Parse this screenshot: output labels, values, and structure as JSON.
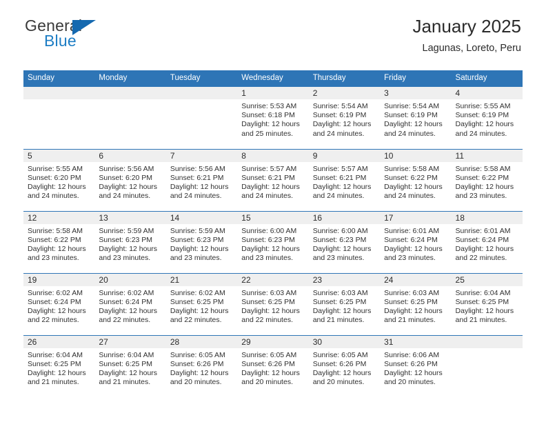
{
  "logo": {
    "word_one": "General",
    "word_two": "Blue",
    "triangle_icon": "triangle-icon"
  },
  "header": {
    "title": "January 2025",
    "subtitle": "Lagunas, Loreto, Peru"
  },
  "colors": {
    "header_blue": "#2E75B6",
    "logo_blue": "#1D7DC4",
    "daynum_band": "#EFEFEF",
    "text": "#2B2B2B"
  },
  "weekday_headers": [
    "Sunday",
    "Monday",
    "Tuesday",
    "Wednesday",
    "Thursday",
    "Friday",
    "Saturday"
  ],
  "weeks": [
    [
      {
        "day": "",
        "empty": true,
        "sunrise": "",
        "sunset": "",
        "daylight_line1": "",
        "daylight_line2": ""
      },
      {
        "day": "",
        "empty": true,
        "sunrise": "",
        "sunset": "",
        "daylight_line1": "",
        "daylight_line2": ""
      },
      {
        "day": "",
        "empty": true,
        "sunrise": "",
        "sunset": "",
        "daylight_line1": "",
        "daylight_line2": ""
      },
      {
        "day": "1",
        "empty": false,
        "sunrise": "Sunrise: 5:53 AM",
        "sunset": "Sunset: 6:18 PM",
        "daylight_line1": "Daylight: 12 hours",
        "daylight_line2": "and 25 minutes."
      },
      {
        "day": "2",
        "empty": false,
        "sunrise": "Sunrise: 5:54 AM",
        "sunset": "Sunset: 6:19 PM",
        "daylight_line1": "Daylight: 12 hours",
        "daylight_line2": "and 24 minutes."
      },
      {
        "day": "3",
        "empty": false,
        "sunrise": "Sunrise: 5:54 AM",
        "sunset": "Sunset: 6:19 PM",
        "daylight_line1": "Daylight: 12 hours",
        "daylight_line2": "and 24 minutes."
      },
      {
        "day": "4",
        "empty": false,
        "sunrise": "Sunrise: 5:55 AM",
        "sunset": "Sunset: 6:19 PM",
        "daylight_line1": "Daylight: 12 hours",
        "daylight_line2": "and 24 minutes."
      }
    ],
    [
      {
        "day": "5",
        "empty": false,
        "sunrise": "Sunrise: 5:55 AM",
        "sunset": "Sunset: 6:20 PM",
        "daylight_line1": "Daylight: 12 hours",
        "daylight_line2": "and 24 minutes."
      },
      {
        "day": "6",
        "empty": false,
        "sunrise": "Sunrise: 5:56 AM",
        "sunset": "Sunset: 6:20 PM",
        "daylight_line1": "Daylight: 12 hours",
        "daylight_line2": "and 24 minutes."
      },
      {
        "day": "7",
        "empty": false,
        "sunrise": "Sunrise: 5:56 AM",
        "sunset": "Sunset: 6:21 PM",
        "daylight_line1": "Daylight: 12 hours",
        "daylight_line2": "and 24 minutes."
      },
      {
        "day": "8",
        "empty": false,
        "sunrise": "Sunrise: 5:57 AM",
        "sunset": "Sunset: 6:21 PM",
        "daylight_line1": "Daylight: 12 hours",
        "daylight_line2": "and 24 minutes."
      },
      {
        "day": "9",
        "empty": false,
        "sunrise": "Sunrise: 5:57 AM",
        "sunset": "Sunset: 6:21 PM",
        "daylight_line1": "Daylight: 12 hours",
        "daylight_line2": "and 24 minutes."
      },
      {
        "day": "10",
        "empty": false,
        "sunrise": "Sunrise: 5:58 AM",
        "sunset": "Sunset: 6:22 PM",
        "daylight_line1": "Daylight: 12 hours",
        "daylight_line2": "and 24 minutes."
      },
      {
        "day": "11",
        "empty": false,
        "sunrise": "Sunrise: 5:58 AM",
        "sunset": "Sunset: 6:22 PM",
        "daylight_line1": "Daylight: 12 hours",
        "daylight_line2": "and 23 minutes."
      }
    ],
    [
      {
        "day": "12",
        "empty": false,
        "sunrise": "Sunrise: 5:58 AM",
        "sunset": "Sunset: 6:22 PM",
        "daylight_line1": "Daylight: 12 hours",
        "daylight_line2": "and 23 minutes."
      },
      {
        "day": "13",
        "empty": false,
        "sunrise": "Sunrise: 5:59 AM",
        "sunset": "Sunset: 6:23 PM",
        "daylight_line1": "Daylight: 12 hours",
        "daylight_line2": "and 23 minutes."
      },
      {
        "day": "14",
        "empty": false,
        "sunrise": "Sunrise: 5:59 AM",
        "sunset": "Sunset: 6:23 PM",
        "daylight_line1": "Daylight: 12 hours",
        "daylight_line2": "and 23 minutes."
      },
      {
        "day": "15",
        "empty": false,
        "sunrise": "Sunrise: 6:00 AM",
        "sunset": "Sunset: 6:23 PM",
        "daylight_line1": "Daylight: 12 hours",
        "daylight_line2": "and 23 minutes."
      },
      {
        "day": "16",
        "empty": false,
        "sunrise": "Sunrise: 6:00 AM",
        "sunset": "Sunset: 6:23 PM",
        "daylight_line1": "Daylight: 12 hours",
        "daylight_line2": "and 23 minutes."
      },
      {
        "day": "17",
        "empty": false,
        "sunrise": "Sunrise: 6:01 AM",
        "sunset": "Sunset: 6:24 PM",
        "daylight_line1": "Daylight: 12 hours",
        "daylight_line2": "and 23 minutes."
      },
      {
        "day": "18",
        "empty": false,
        "sunrise": "Sunrise: 6:01 AM",
        "sunset": "Sunset: 6:24 PM",
        "daylight_line1": "Daylight: 12 hours",
        "daylight_line2": "and 22 minutes."
      }
    ],
    [
      {
        "day": "19",
        "empty": false,
        "sunrise": "Sunrise: 6:02 AM",
        "sunset": "Sunset: 6:24 PM",
        "daylight_line1": "Daylight: 12 hours",
        "daylight_line2": "and 22 minutes."
      },
      {
        "day": "20",
        "empty": false,
        "sunrise": "Sunrise: 6:02 AM",
        "sunset": "Sunset: 6:24 PM",
        "daylight_line1": "Daylight: 12 hours",
        "daylight_line2": "and 22 minutes."
      },
      {
        "day": "21",
        "empty": false,
        "sunrise": "Sunrise: 6:02 AM",
        "sunset": "Sunset: 6:25 PM",
        "daylight_line1": "Daylight: 12 hours",
        "daylight_line2": "and 22 minutes."
      },
      {
        "day": "22",
        "empty": false,
        "sunrise": "Sunrise: 6:03 AM",
        "sunset": "Sunset: 6:25 PM",
        "daylight_line1": "Daylight: 12 hours",
        "daylight_line2": "and 22 minutes."
      },
      {
        "day": "23",
        "empty": false,
        "sunrise": "Sunrise: 6:03 AM",
        "sunset": "Sunset: 6:25 PM",
        "daylight_line1": "Daylight: 12 hours",
        "daylight_line2": "and 21 minutes."
      },
      {
        "day": "24",
        "empty": false,
        "sunrise": "Sunrise: 6:03 AM",
        "sunset": "Sunset: 6:25 PM",
        "daylight_line1": "Daylight: 12 hours",
        "daylight_line2": "and 21 minutes."
      },
      {
        "day": "25",
        "empty": false,
        "sunrise": "Sunrise: 6:04 AM",
        "sunset": "Sunset: 6:25 PM",
        "daylight_line1": "Daylight: 12 hours",
        "daylight_line2": "and 21 minutes."
      }
    ],
    [
      {
        "day": "26",
        "empty": false,
        "sunrise": "Sunrise: 6:04 AM",
        "sunset": "Sunset: 6:25 PM",
        "daylight_line1": "Daylight: 12 hours",
        "daylight_line2": "and 21 minutes."
      },
      {
        "day": "27",
        "empty": false,
        "sunrise": "Sunrise: 6:04 AM",
        "sunset": "Sunset: 6:25 PM",
        "daylight_line1": "Daylight: 12 hours",
        "daylight_line2": "and 21 minutes."
      },
      {
        "day": "28",
        "empty": false,
        "sunrise": "Sunrise: 6:05 AM",
        "sunset": "Sunset: 6:26 PM",
        "daylight_line1": "Daylight: 12 hours",
        "daylight_line2": "and 20 minutes."
      },
      {
        "day": "29",
        "empty": false,
        "sunrise": "Sunrise: 6:05 AM",
        "sunset": "Sunset: 6:26 PM",
        "daylight_line1": "Daylight: 12 hours",
        "daylight_line2": "and 20 minutes."
      },
      {
        "day": "30",
        "empty": false,
        "sunrise": "Sunrise: 6:05 AM",
        "sunset": "Sunset: 6:26 PM",
        "daylight_line1": "Daylight: 12 hours",
        "daylight_line2": "and 20 minutes."
      },
      {
        "day": "31",
        "empty": false,
        "sunrise": "Sunrise: 6:06 AM",
        "sunset": "Sunset: 6:26 PM",
        "daylight_line1": "Daylight: 12 hours",
        "daylight_line2": "and 20 minutes."
      },
      {
        "day": "",
        "empty": true,
        "sunrise": "",
        "sunset": "",
        "daylight_line1": "",
        "daylight_line2": ""
      }
    ]
  ]
}
